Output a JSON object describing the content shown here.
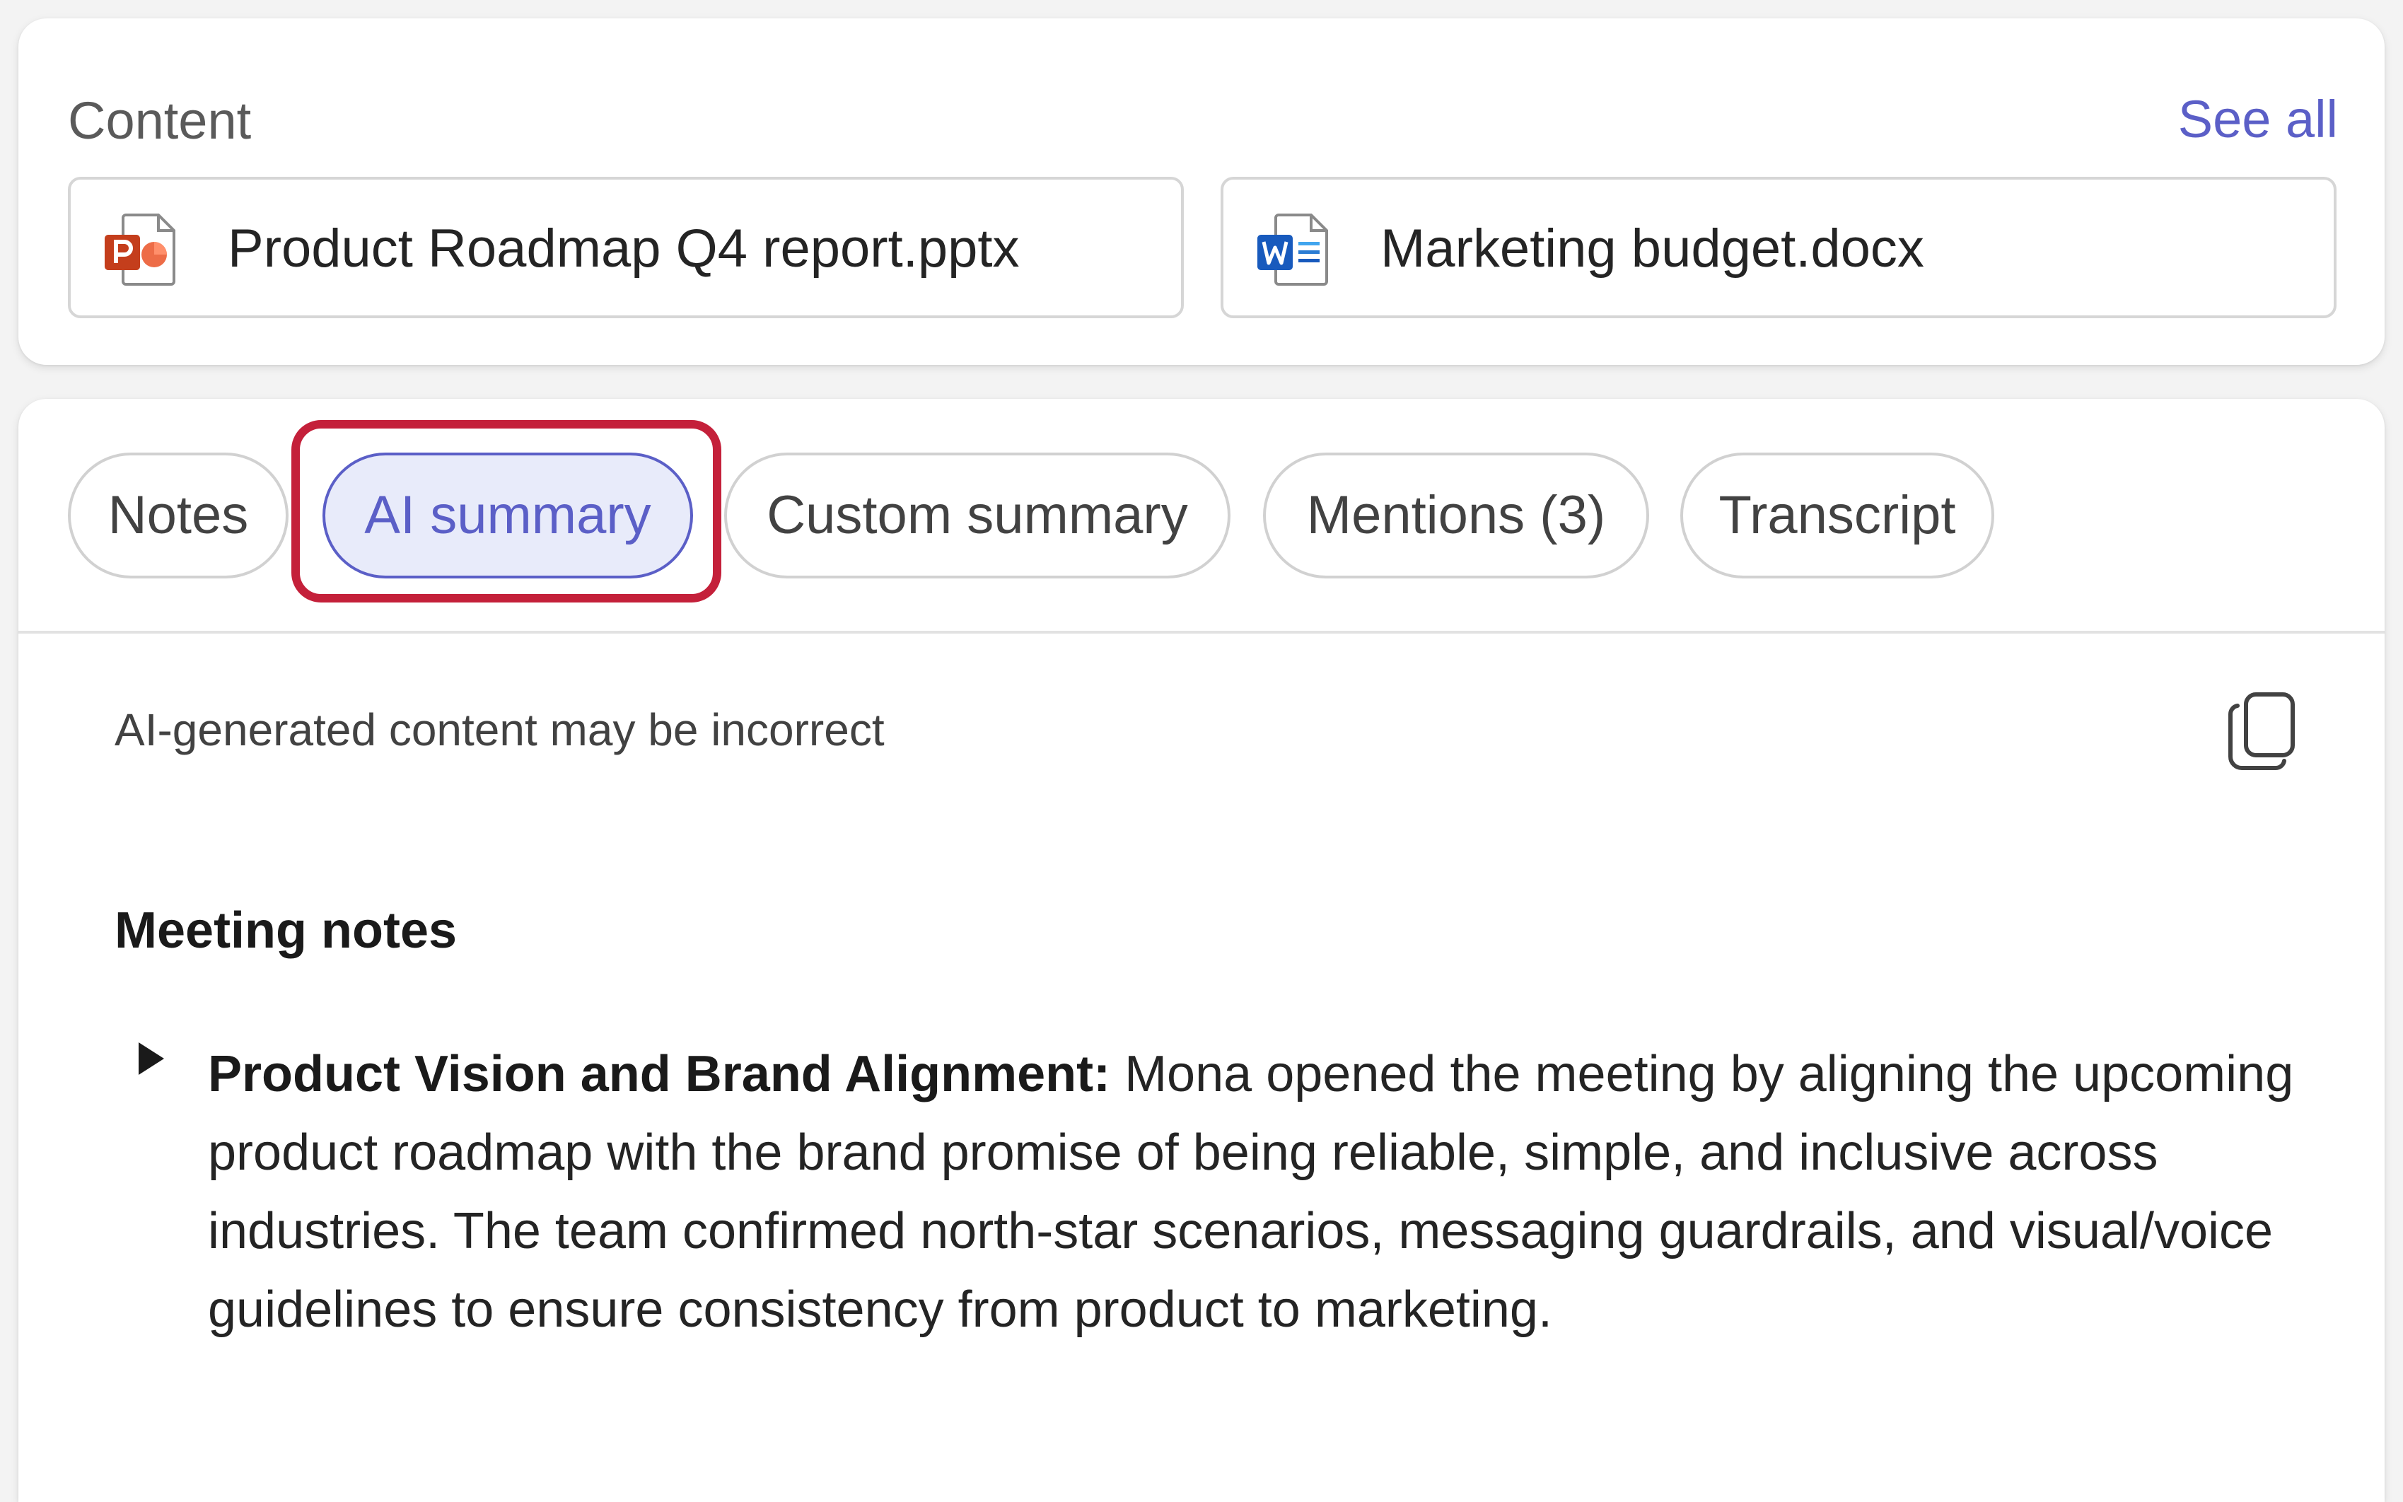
{
  "content_section": {
    "title": "Content",
    "see_all_label": "See all",
    "files": [
      {
        "name": "Product Roadmap Q4 report.pptx",
        "icon": "powerpoint-file-icon",
        "color": "#c43e1c"
      },
      {
        "name": "Marketing budget.docx",
        "icon": "word-file-icon",
        "color": "#185abd"
      }
    ]
  },
  "tabs": [
    {
      "label": "Notes",
      "selected": false
    },
    {
      "label": "AI summary",
      "selected": true
    },
    {
      "label": "Custom summary",
      "selected": false
    },
    {
      "label": "Mentions (3)",
      "selected": false
    },
    {
      "label": "Transcript",
      "selected": false
    }
  ],
  "summary": {
    "disclaimer": "AI-generated content may be incorrect",
    "copy_icon": "copy-icon",
    "section_title": "Meeting notes",
    "items": [
      {
        "heading": "Product Vision and Brand Alignment:",
        "text": " Mona opened the meeting by aligning the upcoming product roadmap with the brand promise of being reliable, simple, and inclusive across industries. The team confirmed north-star scenarios, messaging guardrails, and visual/voice guidelines to ensure consistency from product to marketing."
      }
    ]
  },
  "colors": {
    "accent": "#5b5fc7",
    "highlight": "#c4203a",
    "selected_tab_bg": "#e8ebfa"
  }
}
